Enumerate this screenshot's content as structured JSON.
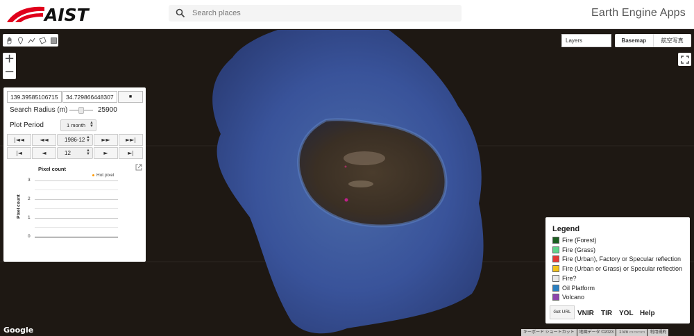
{
  "header": {
    "logo_text": "AIST",
    "search_placeholder": "Search places",
    "app_title": "Earth Engine Apps"
  },
  "map_controls": {
    "draw_tools": [
      "hand-icon",
      "point-icon",
      "line-icon",
      "polygon-icon",
      "rectangle-icon"
    ],
    "zoom_in": "+",
    "zoom_out": "−",
    "layers_label": "Layers",
    "basemap_label": "Basemap",
    "satellite_label": "航空写真"
  },
  "panel": {
    "longitude": "139.39585106715",
    "latitude": "34.729866448307",
    "stop_symbol": "■",
    "radius_label": "Search Radius (m)",
    "radius_value": "25900",
    "radius_level": 0.5,
    "period_label": "Plot Period",
    "period_value": "1 month",
    "nav1": {
      "first": "|◄◄",
      "prev": "◄◄",
      "value": "1986-12",
      "next": "►►",
      "last": "►►|"
    },
    "nav2": {
      "first": "|◄",
      "prev": "◄",
      "value": "12",
      "next": "►",
      "last": "►|"
    }
  },
  "chart_data": {
    "type": "scatter",
    "title": "Pixel count",
    "ylabel": "Pixel count",
    "xlabel": "",
    "legend": [
      {
        "name": "Hot pixel",
        "color": "#ff9900"
      }
    ],
    "yticks": [
      "3",
      "2",
      "1",
      "0"
    ],
    "ylim": [
      0,
      3
    ],
    "series": [
      {
        "name": "Hot pixel",
        "values": []
      }
    ]
  },
  "legend": {
    "title": "Legend",
    "items": [
      {
        "label": "Fire (Forest)",
        "color": "#1b5e20"
      },
      {
        "label": "Fire (Grass)",
        "color": "#5fd38a"
      },
      {
        "label": "Fire (Urban), Factory or Specular reflection",
        "color": "#e53935"
      },
      {
        "label": "Fire (Urban or Grass) or Specular reflection",
        "color": "#f2c21b"
      },
      {
        "label": "Fire?",
        "color": "#e8e8e8"
      },
      {
        "label": "Oil Platform",
        "color": "#2a7fc1"
      },
      {
        "label": "Volcano",
        "color": "#8e44ad"
      }
    ],
    "get_url": "Get URL",
    "links": [
      "VNIR",
      "TIR",
      "YOL",
      "Help"
    ]
  },
  "footer": {
    "google": "Google",
    "shortcuts": "キーボード ショートカット",
    "mapdata": "地図データ ©2023",
    "scale": "1 km",
    "terms": "利用規約"
  }
}
